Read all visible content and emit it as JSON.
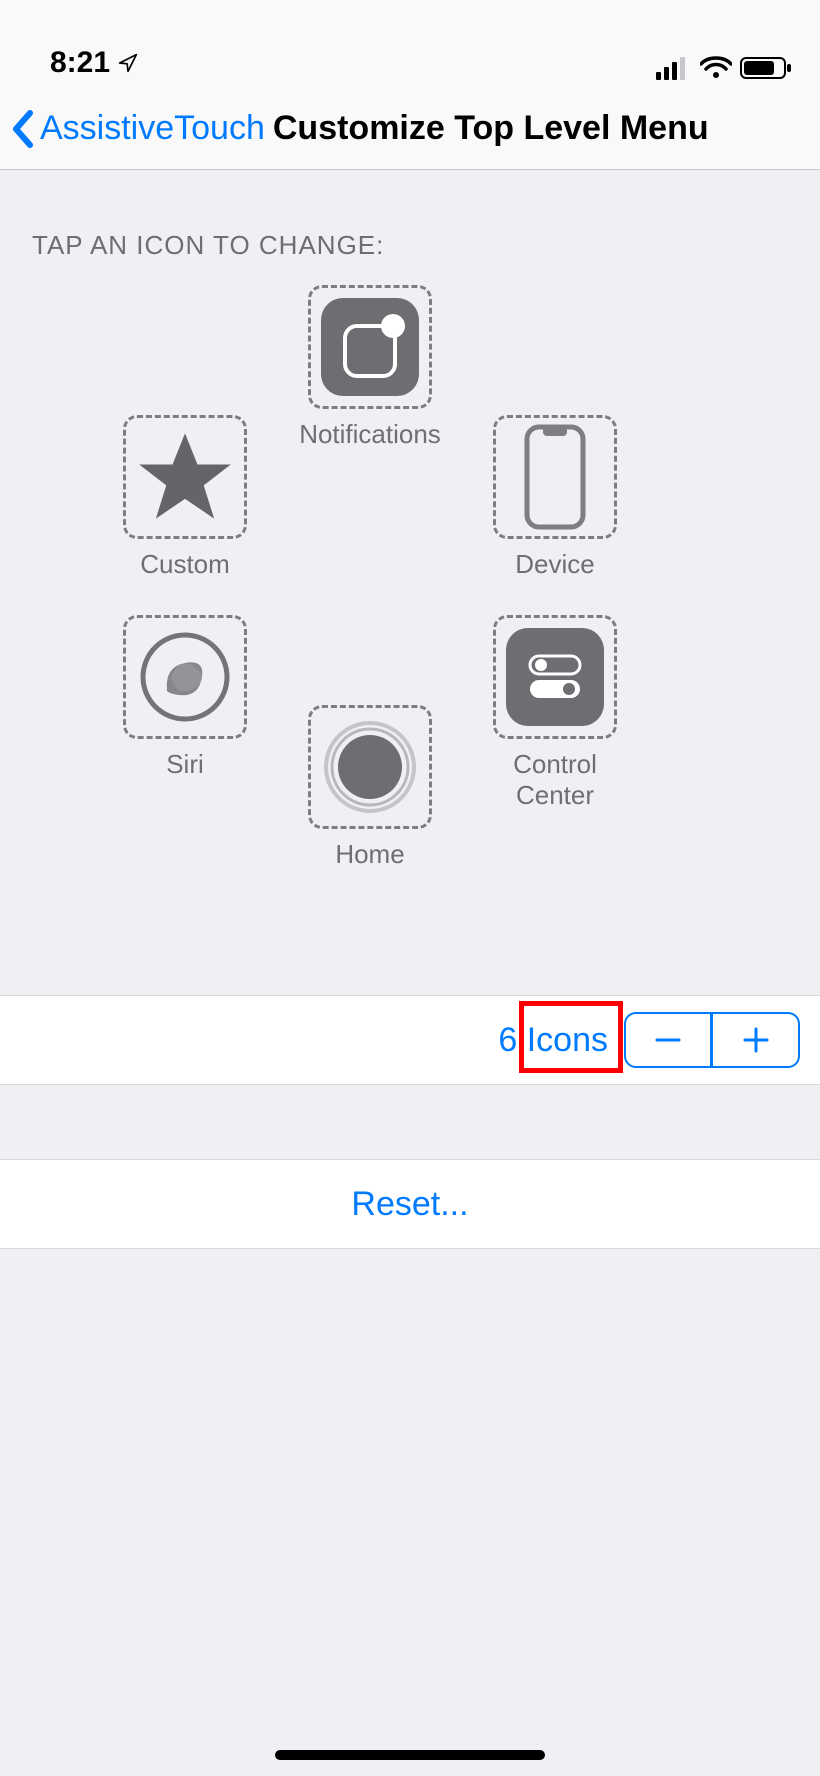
{
  "status": {
    "time": "8:21"
  },
  "nav": {
    "back_label": "AssistiveTouch",
    "title": "Customize Top Level Menu"
  },
  "section": {
    "header": "TAP AN ICON TO CHANGE:"
  },
  "icons": {
    "top": {
      "label": "Notifications"
    },
    "left1": {
      "label": "Custom"
    },
    "right1": {
      "label": "Device"
    },
    "left2": {
      "label": "Siri"
    },
    "right2": {
      "label": "Control Center"
    },
    "bottom": {
      "label": "Home"
    }
  },
  "counter": {
    "label": "6 Icons"
  },
  "reset": {
    "label": "Reset..."
  }
}
